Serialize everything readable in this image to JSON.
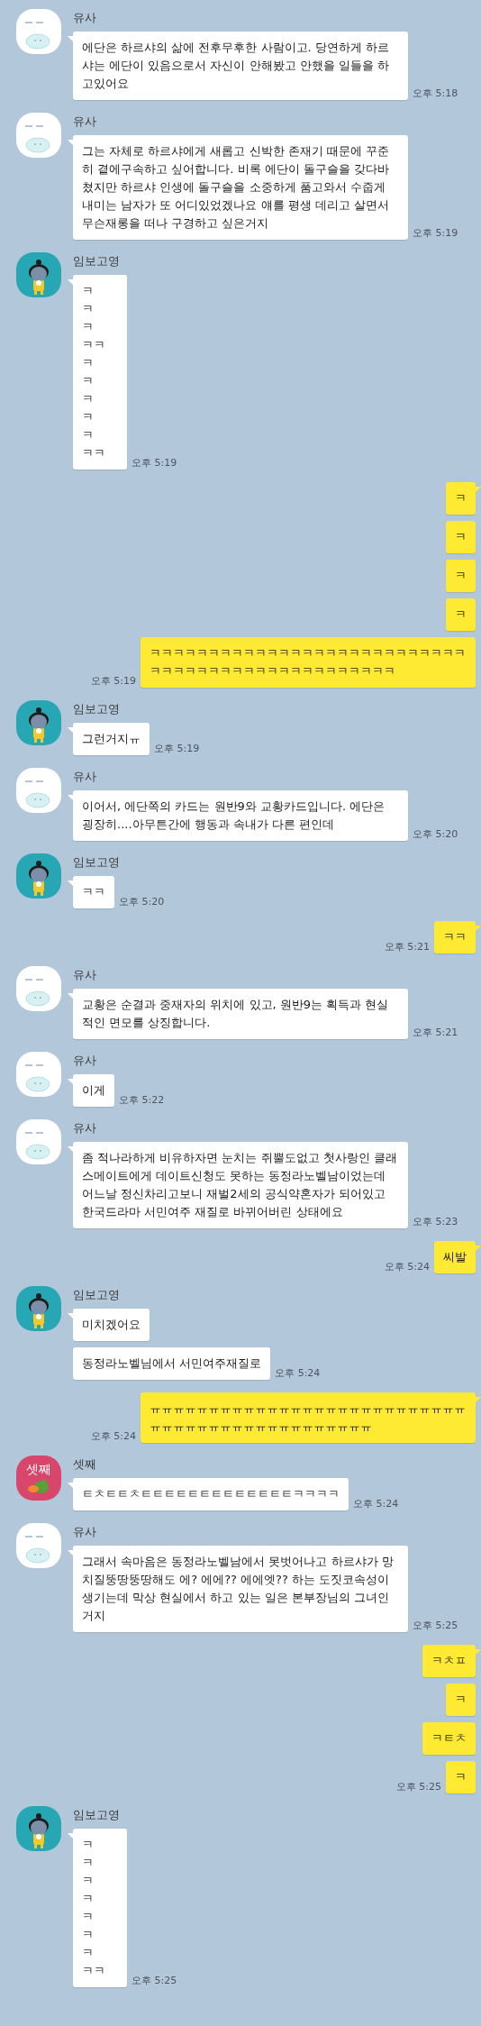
{
  "groups": [
    {
      "kind": "received",
      "name": "유사",
      "avatar": {
        "kind": "slime"
      },
      "bubbles": [
        {
          "text": "에단은 하르샤의 삶에 전후무후한 사람이고. 당연하게 하르샤는 에단이 있음으로서 자신이 안해봤고 안했을 일들을 하고있어요",
          "time": "오후 5:18"
        }
      ]
    },
    {
      "kind": "received",
      "name": "유사",
      "avatar": {
        "kind": "slime"
      },
      "bubbles": [
        {
          "text": "그는 자체로 하르샤에게 새롭고 신박한 존재기 때문에 꾸준히 곁에구속하고 싶어합니다. 비록 에단이 돌구슬을 갖다바쳤지만 하르샤 인생에 돌구슬을 소중하게 품고와서 수줍게 내미는 남자가 또 어디있었겠나요 얘를 평생 데리고 살면서 무슨재롱을 떠나 구경하고 싶은거지",
          "time": "오후 5:19"
        }
      ]
    },
    {
      "kind": "received",
      "name": "임보고영",
      "avatar": {
        "kind": "character"
      },
      "bubbles": [
        {
          "lines": [
            "ㅋ",
            "ㅋ",
            "ㅋ",
            "ㅋㅋ",
            "ㅋ",
            "ㅋ",
            "ㅋ",
            "ㅋ",
            "ㅋ",
            "ㅋㅋ"
          ],
          "time": "오후 5:19"
        }
      ]
    },
    {
      "kind": "sent",
      "bubbles": [
        {
          "text": "ㅋ"
        },
        {
          "text": "ㅋ"
        },
        {
          "text": "ㅋ"
        },
        {
          "text": "ㅋ"
        },
        {
          "text": "ㅋㅋㅋㅋㅋㅋㅋㅋㅋㅋㅋㅋㅋㅋㅋㅋㅋㅋㅋㅋㅋㅋㅋㅋㅋㅋㅋㅋㅋㅋㅋㅋㅋㅋㅋㅋㅋㅋㅋㅋㅋㅋㅋㅋㅋㅋㅋㅋ",
          "time": "오후 5:19"
        }
      ]
    },
    {
      "kind": "received",
      "name": "임보고영",
      "avatar": {
        "kind": "character"
      },
      "bubbles": [
        {
          "text": "그런거지ㅠ",
          "time": "오후 5:19"
        }
      ]
    },
    {
      "kind": "received",
      "name": "유사",
      "avatar": {
        "kind": "slime"
      },
      "bubbles": [
        {
          "text": "이어서, 에단쪽의 카드는 원반9와 교황카드입니다. 에단은 굉장히....아무튼간에 행동과 속내가 다른 편인데",
          "time": "오후 5:20"
        }
      ]
    },
    {
      "kind": "received",
      "name": "임보고영",
      "avatar": {
        "kind": "character"
      },
      "bubbles": [
        {
          "text": "ㅋㅋ",
          "time": "오후 5:20"
        }
      ]
    },
    {
      "kind": "sent",
      "bubbles": [
        {
          "text": "ㅋㅋ",
          "time": "오후 5:21"
        }
      ]
    },
    {
      "kind": "received",
      "name": "유사",
      "avatar": {
        "kind": "slime"
      },
      "bubbles": [
        {
          "text": "교황은 순결과 중재자의 위치에 있고, 원반9는 획득과 현실적인 면모를 상징합니다.",
          "time": "오후 5:21"
        }
      ]
    },
    {
      "kind": "received",
      "name": "유사",
      "avatar": {
        "kind": "slime"
      },
      "bubbles": [
        {
          "text": "이게",
          "time": "오후 5:22"
        }
      ]
    },
    {
      "kind": "received",
      "name": "유사",
      "avatar": {
        "kind": "slime"
      },
      "bubbles": [
        {
          "text": "좀 적나라하게 비유하자면 눈치는 쥐뿔도없고 첫사랑인 클래스메이트에게 데이트신청도 못하는 동정라노벨남이었는데 어느날 정신차리고보니 재벌2세의 공식약혼자가 되어있고 한국드라마 서민여주 재질로 바뀌어버린 상태에요",
          "time": "오후 5:23"
        }
      ]
    },
    {
      "kind": "sent",
      "bubbles": [
        {
          "text": "씨발",
          "time": "오후 5:24"
        }
      ]
    },
    {
      "kind": "received",
      "name": "임보고영",
      "avatar": {
        "kind": "character"
      },
      "bubbles": [
        {
          "text": "미치겠어요"
        },
        {
          "text": "동정라노벨님에서 서민여주재질로",
          "time": "오후 5:24"
        }
      ]
    },
    {
      "kind": "sent",
      "bubbles": [
        {
          "text": "ㅠㅠㅠㅠㅠㅠㅠㅠㅠㅠㅠㅠㅠㅠㅠㅠㅠㅠㅠㅠㅠㅠㅠㅠㅠㅠㅠㅠㅠㅠㅠㅠㅠㅠㅠㅠㅠㅠㅠㅠㅠㅠㅠㅠㅠㅠ",
          "time": "오후 5:24"
        }
      ]
    },
    {
      "kind": "received",
      "name": "셋째",
      "avatar": {
        "kind": "label",
        "text": "셋째"
      },
      "bubbles": [
        {
          "text": "ㅌㅊㅌㅌㅊㅌㅌㅌㅌㅌㅌㅌㅌㅌㅌㅌㅌㅌㅋㅋㅋㅋ",
          "time": "오후 5:24"
        }
      ]
    },
    {
      "kind": "received",
      "name": "유사",
      "avatar": {
        "kind": "slime"
      },
      "bubbles": [
        {
          "text": "그래서 속마음은 동정라노벨남에서 못벗어나고 하르샤가 망치질뚱땅뚱땅해도 에? 에에?? 에에엣?? 하는 도짓코속성이 생기는데 막상 현실에서 하고 있는 일은 본부장님의 그녀인거지",
          "time": "오후 5:25"
        }
      ]
    },
    {
      "kind": "sent",
      "bubbles": [
        {
          "text": "ㅋㅊㅍ"
        },
        {
          "text": "ㅋ"
        },
        {
          "text": "ㅋㅌㅊ"
        },
        {
          "text": "ㅋ",
          "time": "오후 5:25"
        }
      ]
    },
    {
      "kind": "received",
      "name": "임보고영",
      "avatar": {
        "kind": "character"
      },
      "bubbles": [
        {
          "lines": [
            "ㅋ",
            "ㅋ",
            "ㅋ",
            "ㅋ",
            "ㅋ",
            "ㅋ",
            "ㅋ",
            "ㅋㅋ"
          ],
          "time": "오후 5:25"
        }
      ]
    }
  ]
}
